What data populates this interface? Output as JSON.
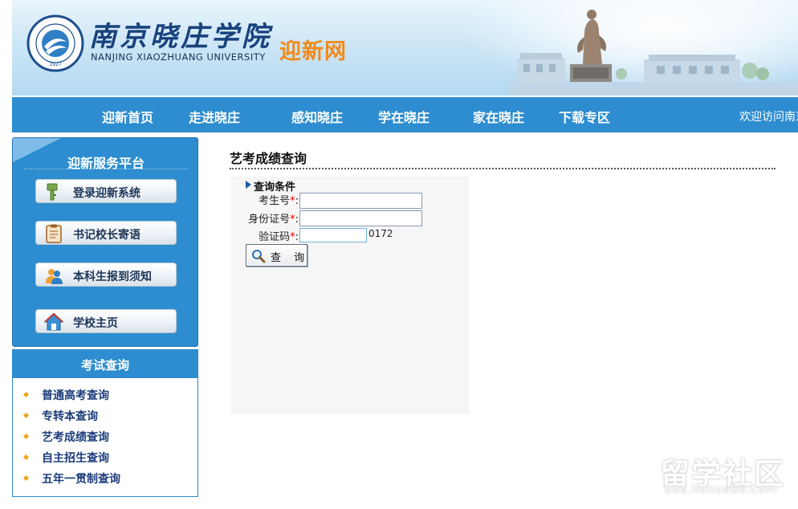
{
  "header": {
    "school_name_cn": "南京晓庄学院",
    "school_name_en": "NANJING XIAOZHUANG UNIVERSITY",
    "site_title": "迎新网",
    "seal_year": "1927",
    "seal_text": "南京晓庄学院",
    "seal_en": "Nanjing Xiaozhuang University"
  },
  "nav": {
    "items": [
      "迎新首页",
      "走进晓庄",
      "感知晓庄",
      "学在晓庄",
      "家在晓庄",
      "下载专区"
    ],
    "welcome": "欢迎访问南京晓庄学院迎新网"
  },
  "service_panel": {
    "title": "迎新服务平台",
    "buttons": [
      {
        "label": "登录迎新系统",
        "icon": "key-icon"
      },
      {
        "label": "书记校长寄语",
        "icon": "clipboard-icon"
      },
      {
        "label": "本科生报到须知",
        "icon": "users-icon"
      },
      {
        "label": "学校主页",
        "icon": "home-icon"
      }
    ]
  },
  "exam_panel": {
    "title": "考试查询",
    "items": [
      "普通高考查询",
      "专转本查询",
      "艺考成绩查询",
      "自主招生查询",
      "五年一贯制查询"
    ]
  },
  "content": {
    "title": "艺考成绩查询",
    "conditions_title": "查询条件",
    "fields": {
      "exam_number": {
        "label": "考生号",
        "value": ""
      },
      "id_number": {
        "label": "身份证号",
        "value": ""
      },
      "captcha": {
        "label": "验证码",
        "value": ""
      }
    },
    "required_mark": "*",
    "label_colon": ":",
    "captcha_code": "0172",
    "search_label": "查 询"
  },
  "watermark": {
    "text": "留学社区",
    "url": "bbs.liuxue86.com"
  },
  "colors": {
    "nav_blue": "#2d8dd0",
    "title_orange": "#f08a1a",
    "school_blue": "#17427d",
    "required_red": "#e00000",
    "bullet_orange": "#f2a41a"
  }
}
